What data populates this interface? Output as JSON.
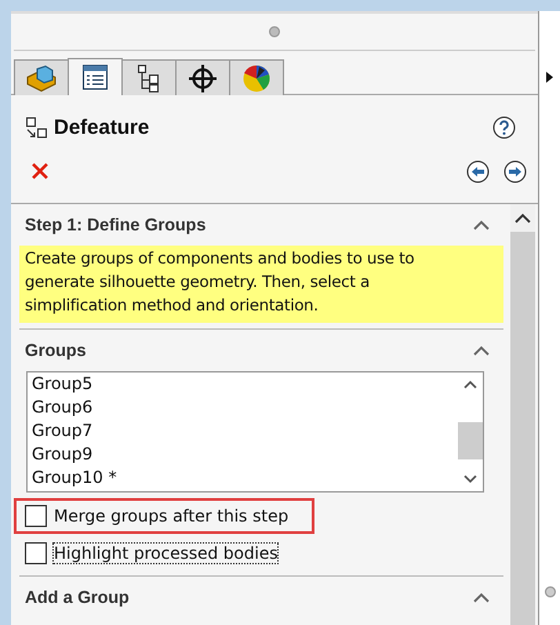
{
  "tabs": [
    {
      "kind": "part",
      "selected": false
    },
    {
      "kind": "properties",
      "selected": true
    },
    {
      "kind": "configurations",
      "selected": false
    },
    {
      "kind": "target",
      "selected": false
    },
    {
      "kind": "appearance",
      "selected": false
    }
  ],
  "panel": {
    "title": "Defeature"
  },
  "step": {
    "title": "Step 1: Define Groups",
    "expanded": true,
    "message": "Create groups of components and bodies to use to generate silhouette geometry. Then, select a simplification method and orientation."
  },
  "groups": {
    "title": "Groups",
    "expanded": true,
    "items": [
      "Group5",
      "Group6",
      "Group7",
      "Group9",
      "Group10 *"
    ],
    "options": [
      {
        "label": "Merge groups after this step",
        "checked": false,
        "highlighted": true,
        "focused": false
      },
      {
        "label": "Highlight processed bodies",
        "checked": false,
        "highlighted": false,
        "focused": true
      }
    ]
  },
  "add_group": {
    "title": "Add a Group",
    "expanded": true
  }
}
